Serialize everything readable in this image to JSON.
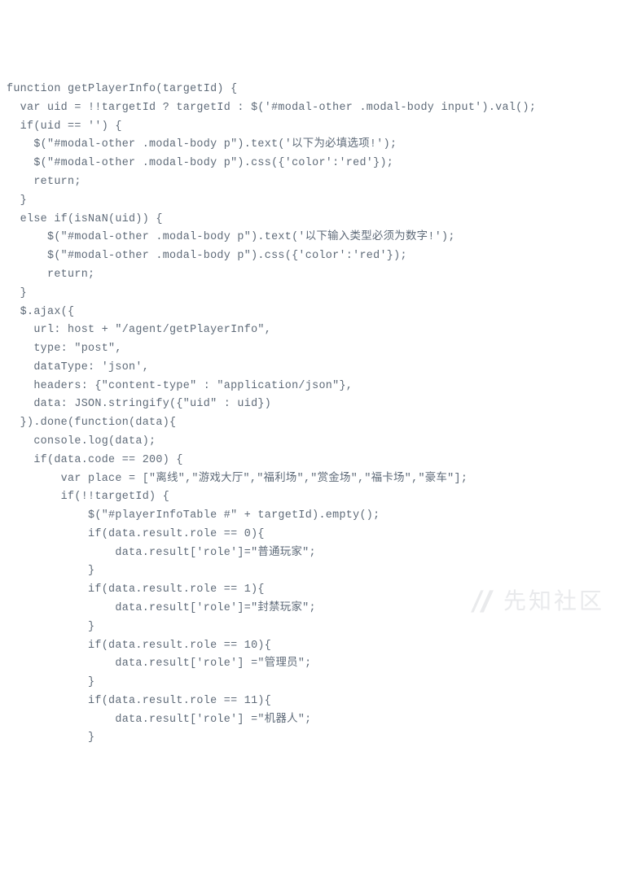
{
  "code": {
    "lines": [
      "function getPlayerInfo(targetId) {",
      "  var uid = !!targetId ? targetId : $('#modal-other .modal-body input').val();",
      "  if(uid == '') {",
      "    $(\"#modal-other .modal-body p\").text('以下为必填选项!');",
      "    $(\"#modal-other .modal-body p\").css({'color':'red'});",
      "    return;",
      "  }",
      "  else if(isNaN(uid)) {",
      "      $(\"#modal-other .modal-body p\").text('以下输入类型必须为数字!');",
      "      $(\"#modal-other .modal-body p\").css({'color':'red'});",
      "      return;",
      "  }",
      "  $.ajax({",
      "    url: host + \"/agent/getPlayerInfo\",",
      "    type: \"post\",",
      "    dataType: 'json',",
      "    headers: {\"content-type\" : \"application/json\"},",
      "    data: JSON.stringify({\"uid\" : uid})",
      "  }).done(function(data){",
      "    console.log(data);",
      "    if(data.code == 200) {",
      "        var place = [\"离线\",\"游戏大厅\",\"福利场\",\"赏金场\",\"福卡场\",\"豪车\"];",
      "        if(!!targetId) {",
      "            $(\"#playerInfoTable #\" + targetId).empty();",
      "            if(data.result.role == 0){",
      "                data.result['role']=\"普通玩家\";",
      "            }",
      "            if(data.result.role == 1){",
      "                data.result['role']=\"封禁玩家\";",
      "            }",
      "            if(data.result.role == 10){",
      "                data.result['role'] =\"管理员\";",
      "            }",
      "            if(data.result.role == 11){",
      "                data.result['role'] =\"机器人\";",
      "            }"
    ]
  },
  "watermark": {
    "text": "先知社区"
  }
}
